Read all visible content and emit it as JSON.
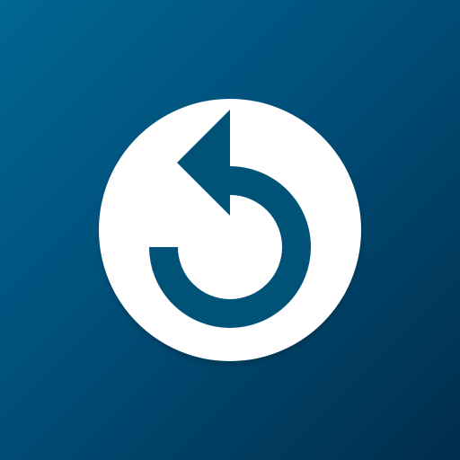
{
  "app_icon": {
    "icon": "undo-icon",
    "colors": {
      "background_light": "#006692",
      "background_mid": "#004f79",
      "background_dark": "#002d4b",
      "badge": "#ffffff",
      "glyph": "#005276"
    }
  }
}
